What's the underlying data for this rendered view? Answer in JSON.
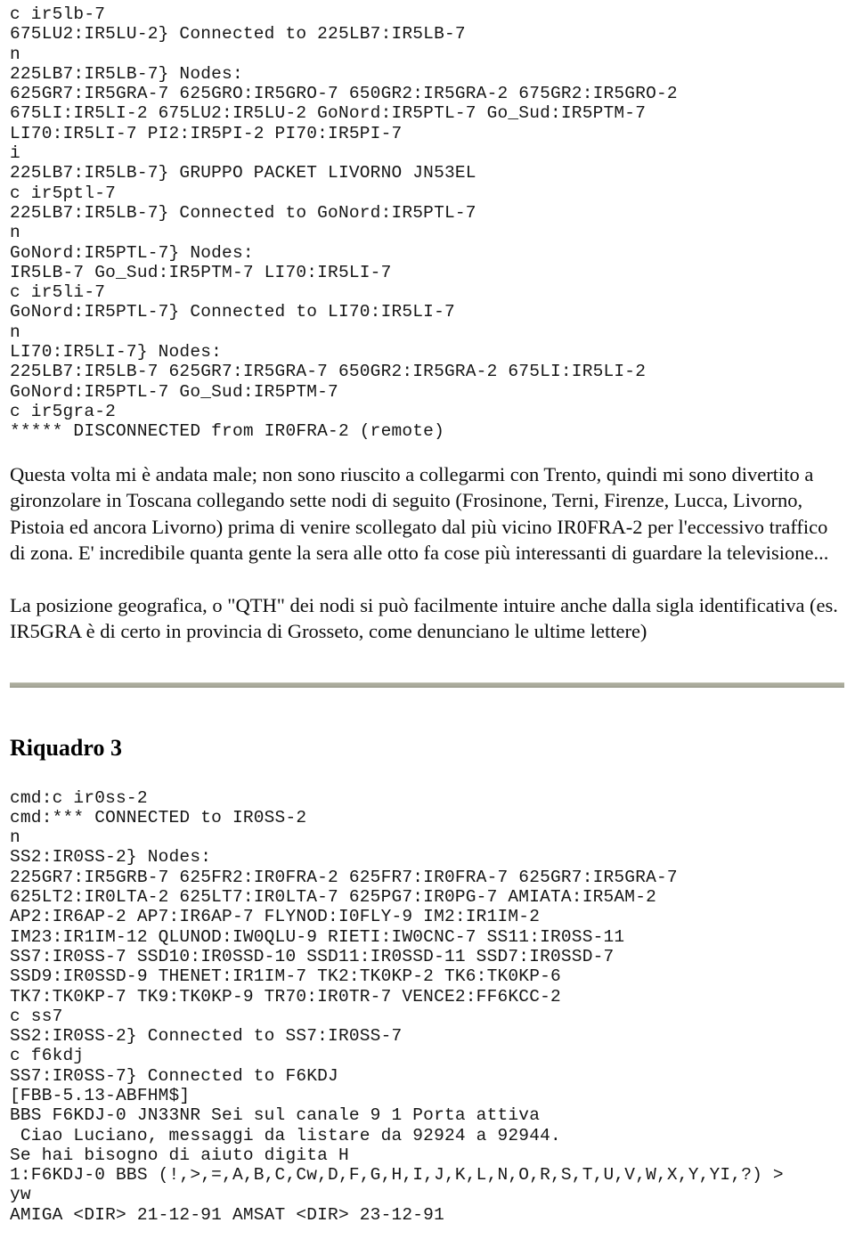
{
  "document": {
    "terminal_top_lines": [
      "c ir5lb-7",
      "675LU2:IR5LU-2} Connected to 225LB7:IR5LB-7",
      "n",
      "225LB7:IR5LB-7} Nodes:",
      "625GR7:IR5GRA-7 625GRO:IR5GRO-7 650GR2:IR5GRA-2 675GR2:IR5GRO-2",
      "675LI:IR5LI-2 675LU2:IR5LU-2 GoNord:IR5PTL-7 Go_Sud:IR5PTM-7",
      "LI70:IR5LI-7 PI2:IR5PI-2 PI70:IR5PI-7",
      "i",
      "225LB7:IR5LB-7} GRUPPO PACKET LIVORNO JN53EL",
      "c ir5ptl-7",
      "225LB7:IR5LB-7} Connected to GoNord:IR5PTL-7",
      "n",
      "GoNord:IR5PTL-7} Nodes:",
      "IR5LB-7 Go_Sud:IR5PTM-7 LI70:IR5LI-7",
      "c ir5li-7",
      "GoNord:IR5PTL-7} Connected to LI70:IR5LI-7",
      "n",
      "LI70:IR5LI-7} Nodes:",
      "225LB7:IR5LB-7 625GR7:IR5GRA-7 650GR2:IR5GRA-2 675LI:IR5LI-2",
      "GoNord:IR5PTL-7 Go_Sud:IR5PTM-7",
      "c ir5gra-2",
      "***** DISCONNECTED from IR0FRA-2 (remote)"
    ],
    "paragraph_1": "Questa volta mi è andata male; non sono riuscito a collegarmi con Trento, quindi mi sono divertito a gironzolare in Toscana collegando sette nodi di seguito (Frosinone, Terni, Firenze, Lucca, Livorno, Pistoia ed ancora Livorno) prima di venire scollegato dal più vicino IR0FRA-2 per l'eccessivo traffico di zona. E' incredibile quanta gente la sera alle otto fa cose più interessanti di guardare la televisione...",
    "paragraph_2": "La posizione geografica, o \"QTH\" dei nodi si può facilmente intuire anche dalla sigla identificativa (es. IR5GRA è di certo in provincia di Grosseto, come denunciano le ultime lettere)",
    "section_heading": "Riquadro 3",
    "divider_color": "#aaab9c",
    "terminal_bottom_lines": [
      "cmd:c ir0ss-2",
      "cmd:*** CONNECTED to IR0SS-2",
      "n",
      "SS2:IR0SS-2} Nodes:",
      "225GR7:IR5GRB-7 625FR2:IR0FRA-2 625FR7:IR0FRA-7 625GR7:IR5GRA-7",
      "625LT2:IR0LTA-2 625LT7:IR0LTA-7 625PG7:IR0PG-7 AMIATA:IR5AM-2",
      "AP2:IR6AP-2 AP7:IR6AP-7 FLYNOD:I0FLY-9 IM2:IR1IM-2",
      "IM23:IR1IM-12 QLUNOD:IW0QLU-9 RIETI:IW0CNC-7 SS11:IR0SS-11",
      "SS7:IR0SS-7 SSD10:IR0SSD-10 SSD11:IR0SSD-11 SSD7:IR0SSD-7",
      "SSD9:IR0SSD-9 THENET:IR1IM-7 TK2:TK0KP-2 TK6:TK0KP-6",
      "TK7:TK0KP-7 TK9:TK0KP-9 TR70:IR0TR-7 VENCE2:FF6KCC-2",
      "c ss7",
      "SS2:IR0SS-2} Connected to SS7:IR0SS-7",
      "c f6kdj",
      "SS7:IR0SS-7} Connected to F6KDJ",
      "[FBB-5.13-ABFHM$]",
      "BBS F6KDJ-0 JN33NR Sei sul canale 9 1 Porta attiva",
      " Ciao Luciano, messaggi da listare da 92924 a 92944.",
      "Se hai bisogno di aiuto digita H",
      "1:F6KDJ-0 BBS (!,>,=,A,B,C,Cw,D,F,G,H,I,J,K,L,N,O,R,S,T,U,V,W,X,Y,YI,?) >",
      "yw",
      "AMIGA <DIR> 21-12-91 AMSAT <DIR> 23-12-91"
    ]
  }
}
